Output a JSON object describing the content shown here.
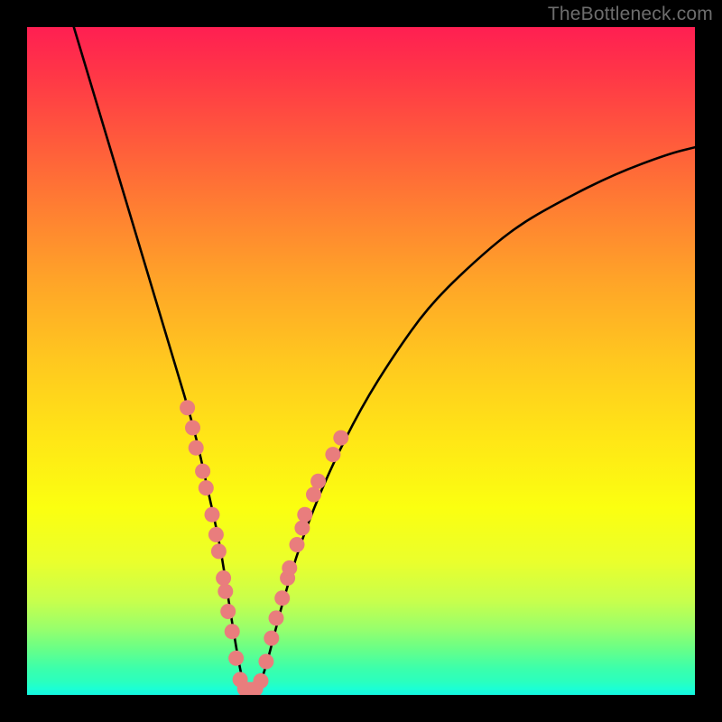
{
  "watermark": "TheBottleneck.com",
  "colors": {
    "frame": "#000000",
    "curve": "#000000",
    "dot_fill": "#e97d7d",
    "dot_stroke": "#c95c5c",
    "gradient_top": "#ff1f52",
    "gradient_bottom": "#14f6e0"
  },
  "chart_data": {
    "type": "line",
    "title": "",
    "xlabel": "",
    "ylabel": "",
    "xlim": [
      0,
      100
    ],
    "ylim": [
      0,
      100
    ],
    "series": [
      {
        "name": "bottleneck_curve",
        "description": "V-shaped bottleneck curve; y is approximate percent bottleneck (0 = optimal green, 100 = worst red)",
        "x": [
          7,
          10,
          13,
          16,
          19,
          22,
          25,
          27,
          29,
          30.5,
          32,
          33,
          34,
          35.5,
          38,
          41,
          45,
          50,
          55,
          60,
          66,
          73,
          80,
          88,
          96,
          100
        ],
        "y": [
          100,
          90,
          80,
          70,
          60,
          50,
          40,
          31,
          22,
          12,
          3,
          0,
          0,
          3,
          13,
          23,
          33,
          43,
          51,
          58,
          64,
          70,
          74,
          78,
          81,
          82
        ]
      }
    ],
    "markers": {
      "name": "highlight_dots",
      "description": "Salmon dots clustered near the curve's minimum on both branches",
      "points": [
        {
          "x": 24.0,
          "y": 43.0
        },
        {
          "x": 24.8,
          "y": 40.0
        },
        {
          "x": 25.3,
          "y": 37.0
        },
        {
          "x": 26.3,
          "y": 33.5
        },
        {
          "x": 26.8,
          "y": 31.0
        },
        {
          "x": 27.7,
          "y": 27.0
        },
        {
          "x": 28.3,
          "y": 24.0
        },
        {
          "x": 28.7,
          "y": 21.5
        },
        {
          "x": 29.4,
          "y": 17.5
        },
        {
          "x": 29.7,
          "y": 15.5
        },
        {
          "x": 30.1,
          "y": 12.5
        },
        {
          "x": 30.7,
          "y": 9.5
        },
        {
          "x": 31.3,
          "y": 5.5
        },
        {
          "x": 31.9,
          "y": 2.3
        },
        {
          "x": 32.6,
          "y": 0.9
        },
        {
          "x": 33.4,
          "y": 0.8
        },
        {
          "x": 34.2,
          "y": 0.9
        },
        {
          "x": 35.0,
          "y": 2.1
        },
        {
          "x": 35.8,
          "y": 5.0
        },
        {
          "x": 36.6,
          "y": 8.5
        },
        {
          "x": 37.3,
          "y": 11.5
        },
        {
          "x": 38.2,
          "y": 14.5
        },
        {
          "x": 39.0,
          "y": 17.5
        },
        {
          "x": 39.3,
          "y": 19.0
        },
        {
          "x": 40.4,
          "y": 22.5
        },
        {
          "x": 41.2,
          "y": 25.0
        },
        {
          "x": 41.6,
          "y": 27.0
        },
        {
          "x": 42.9,
          "y": 30.0
        },
        {
          "x": 43.6,
          "y": 32.0
        },
        {
          "x": 45.8,
          "y": 36.0
        },
        {
          "x": 47.0,
          "y": 38.5
        }
      ]
    }
  }
}
